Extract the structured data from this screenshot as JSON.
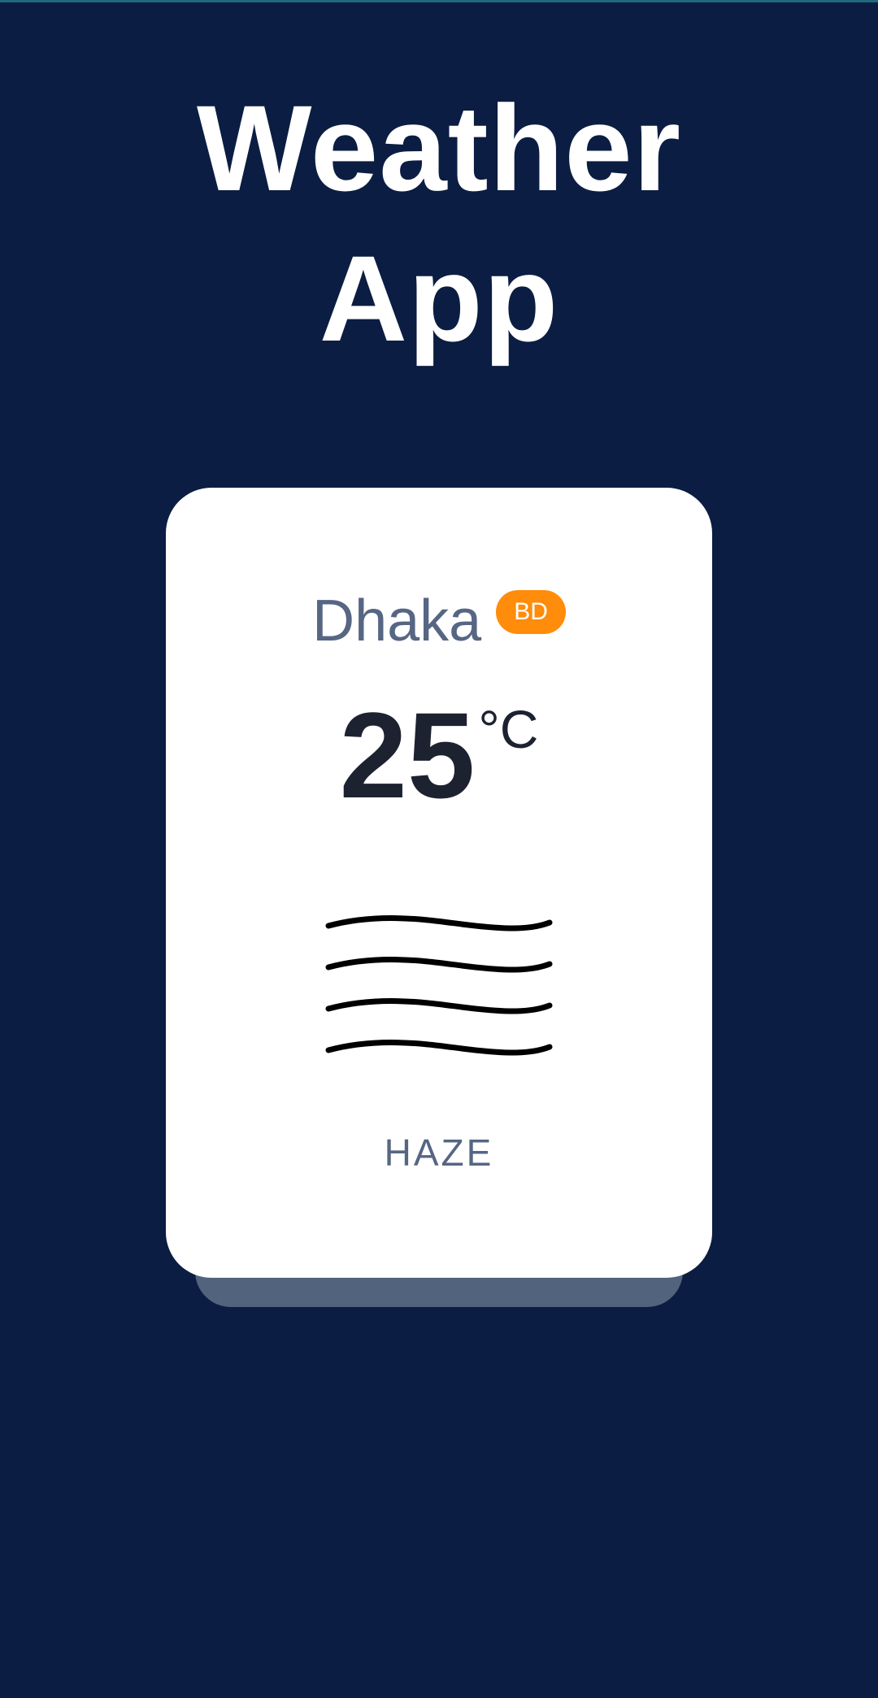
{
  "app": {
    "title_line1": "Weather",
    "title_line2": "App"
  },
  "weather": {
    "city": "Dhaka",
    "country_code": "BD",
    "temperature": "25",
    "unit": "°C",
    "condition": "HAZE",
    "icon": "haze-icon"
  },
  "colors": {
    "background": "#0b1d42",
    "card": "#ffffff",
    "card_shadow": "#52637e",
    "badge": "#ff8c0a",
    "city_text": "#566683",
    "temperature_text": "#1d2231"
  }
}
